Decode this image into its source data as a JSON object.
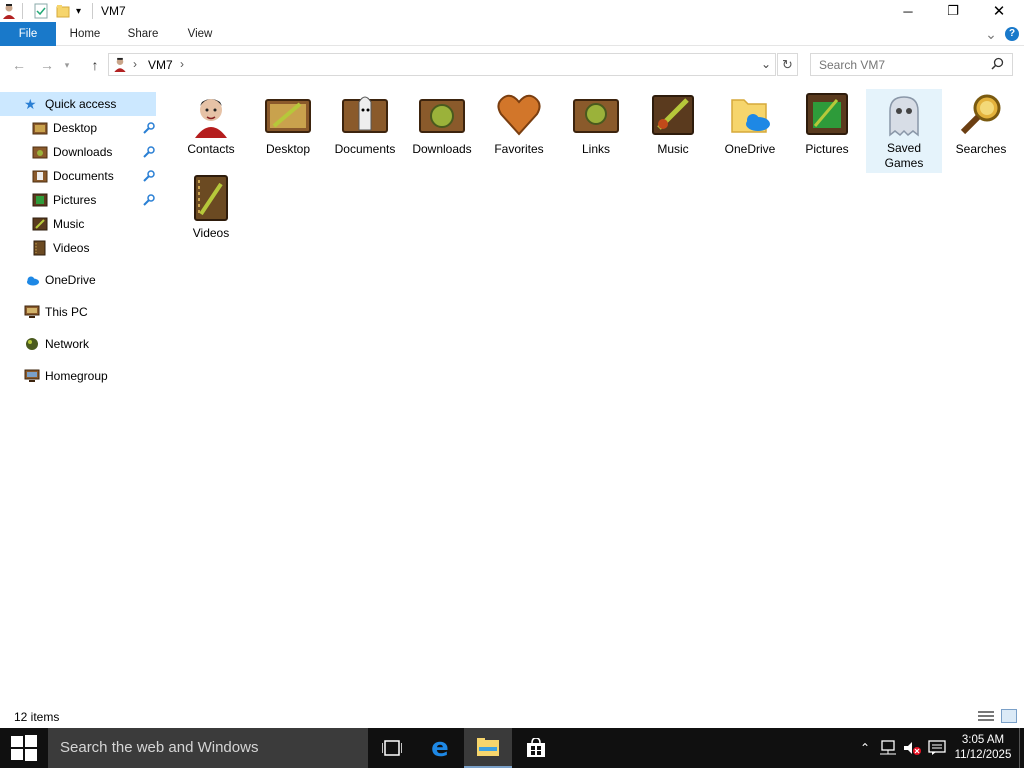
{
  "window": {
    "title": "VM7",
    "minimize_glyph": "─",
    "maximize_glyph": "❐",
    "close_glyph": "✕"
  },
  "ribbon": {
    "tabs": [
      "File",
      "Home",
      "Share",
      "View"
    ],
    "expand_glyph": "⌄",
    "help_glyph": "?"
  },
  "address": {
    "path": "VM7",
    "separator": "›",
    "search_placeholder": "Search VM7"
  },
  "navpane": {
    "quick_access": "Quick access",
    "quick_items": [
      "Desktop",
      "Downloads",
      "Documents",
      "Pictures",
      "Music",
      "Videos"
    ],
    "onedrive": "OneDrive",
    "this_pc": "This PC",
    "network": "Network",
    "homegroup": "Homegroup"
  },
  "content": {
    "items": [
      {
        "label": "Contacts",
        "icon": "contacts-icon"
      },
      {
        "label": "Desktop",
        "icon": "desktop-folder-icon"
      },
      {
        "label": "Documents",
        "icon": "documents-folder-icon"
      },
      {
        "label": "Downloads",
        "icon": "downloads-folder-icon"
      },
      {
        "label": "Favorites",
        "icon": "favorites-heart-icon"
      },
      {
        "label": "Links",
        "icon": "links-folder-icon"
      },
      {
        "label": "Music",
        "icon": "music-folder-icon"
      },
      {
        "label": "OneDrive",
        "icon": "onedrive-folder-icon"
      },
      {
        "label": "Pictures",
        "icon": "pictures-folder-icon"
      },
      {
        "label": "Saved Games",
        "icon": "saved-games-ghost-icon"
      },
      {
        "label": "Searches",
        "icon": "searches-magnifier-icon"
      },
      {
        "label": "Videos",
        "icon": "videos-folder-icon"
      }
    ],
    "selected": "Saved Games"
  },
  "status": {
    "item_count": "12 items"
  },
  "taskbar": {
    "search_text": "Search the web and Windows",
    "time": "3:05 AM",
    "date": "11/12/2025"
  },
  "colors": {
    "accent": "#1979ca",
    "selection": "#e5f3fb",
    "folder_brown": "#8a5a2b",
    "taskbar": "#101010"
  }
}
